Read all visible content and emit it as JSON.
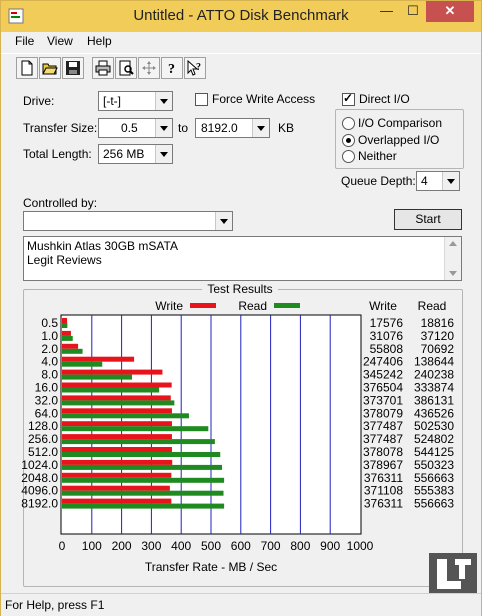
{
  "window": {
    "title": "Untitled - ATTO Disk Benchmark"
  },
  "menu": [
    "File",
    "View",
    "Help"
  ],
  "toolbar": {
    "buttons": [
      "new-icon",
      "open-icon",
      "save-icon",
      "print-icon",
      "print-preview-icon",
      "move-icon",
      "help-icon",
      "context-help-icon"
    ]
  },
  "form": {
    "drive_label": "Drive:",
    "drive_value": "[-t-]",
    "force_write_label": "Force Write Access",
    "force_write_checked": false,
    "direct_io_label": "Direct I/O",
    "direct_io_checked": true,
    "transfer_size_label": "Transfer Size:",
    "transfer_from": "0.5",
    "to_label": "to",
    "transfer_to": "8192.0",
    "kb_label": "KB",
    "total_length_label": "Total Length:",
    "total_length_value": "256 MB",
    "io_comparison_label": "I/O Comparison",
    "overlapped_io_label": "Overlapped I/O",
    "neither_label": "Neither",
    "io_mode_selected": "Overlapped I/O",
    "queue_depth_label": "Queue Depth:",
    "queue_depth_value": "4",
    "controlled_by_label": "Controlled by:",
    "controlled_by_value": "",
    "start_label": "Start",
    "notes": [
      "Mushkin Atlas 30GB mSATA",
      "Legit Reviews"
    ]
  },
  "results": {
    "group_title": "Test Results",
    "write_legend": "Write",
    "read_legend": "Read",
    "write_col_header": "Write",
    "read_col_header": "Read",
    "write_color": "#e8141b",
    "read_color": "#1f8a1f",
    "grid_color": "#2020c0"
  },
  "chart_data": {
    "type": "bar",
    "orientation": "horizontal",
    "categories": [
      "0.5",
      "1.0",
      "2.0",
      "4.0",
      "8.0",
      "16.0",
      "32.0",
      "64.0",
      "128.0",
      "256.0",
      "512.0",
      "1024.0",
      "2048.0",
      "4096.0",
      "8192.0"
    ],
    "series": [
      {
        "name": "Write",
        "values": [
          17,
          30,
          54,
          242,
          337,
          368,
          365,
          369,
          369,
          369,
          369,
          370,
          367,
          362,
          367
        ],
        "table_values": [
          "17576",
          "31076",
          "55808",
          "247406",
          "345242",
          "376504",
          "373701",
          "378079",
          "377487",
          "377487",
          "378078",
          "378967",
          "376311",
          "371108",
          "376311"
        ]
      },
      {
        "name": "Read",
        "values": [
          18,
          36,
          69,
          135,
          235,
          326,
          377,
          426,
          491,
          513,
          531,
          537,
          544,
          542,
          544
        ],
        "table_values": [
          "18816",
          "37120",
          "70692",
          "138644",
          "240238",
          "333874",
          "386131",
          "436526",
          "502530",
          "524802",
          "544125",
          "550323",
          "556663",
          "555383",
          "556663"
        ]
      }
    ],
    "xlabel": "Transfer Rate - MB / Sec",
    "xlim": [
      0,
      1000
    ],
    "xticks": [
      "0",
      "100",
      "200",
      "300",
      "400",
      "500",
      "600",
      "700",
      "800",
      "900",
      "1000"
    ],
    "grid": true,
    "legend": "top"
  },
  "status": {
    "text": "For Help, press F1"
  }
}
